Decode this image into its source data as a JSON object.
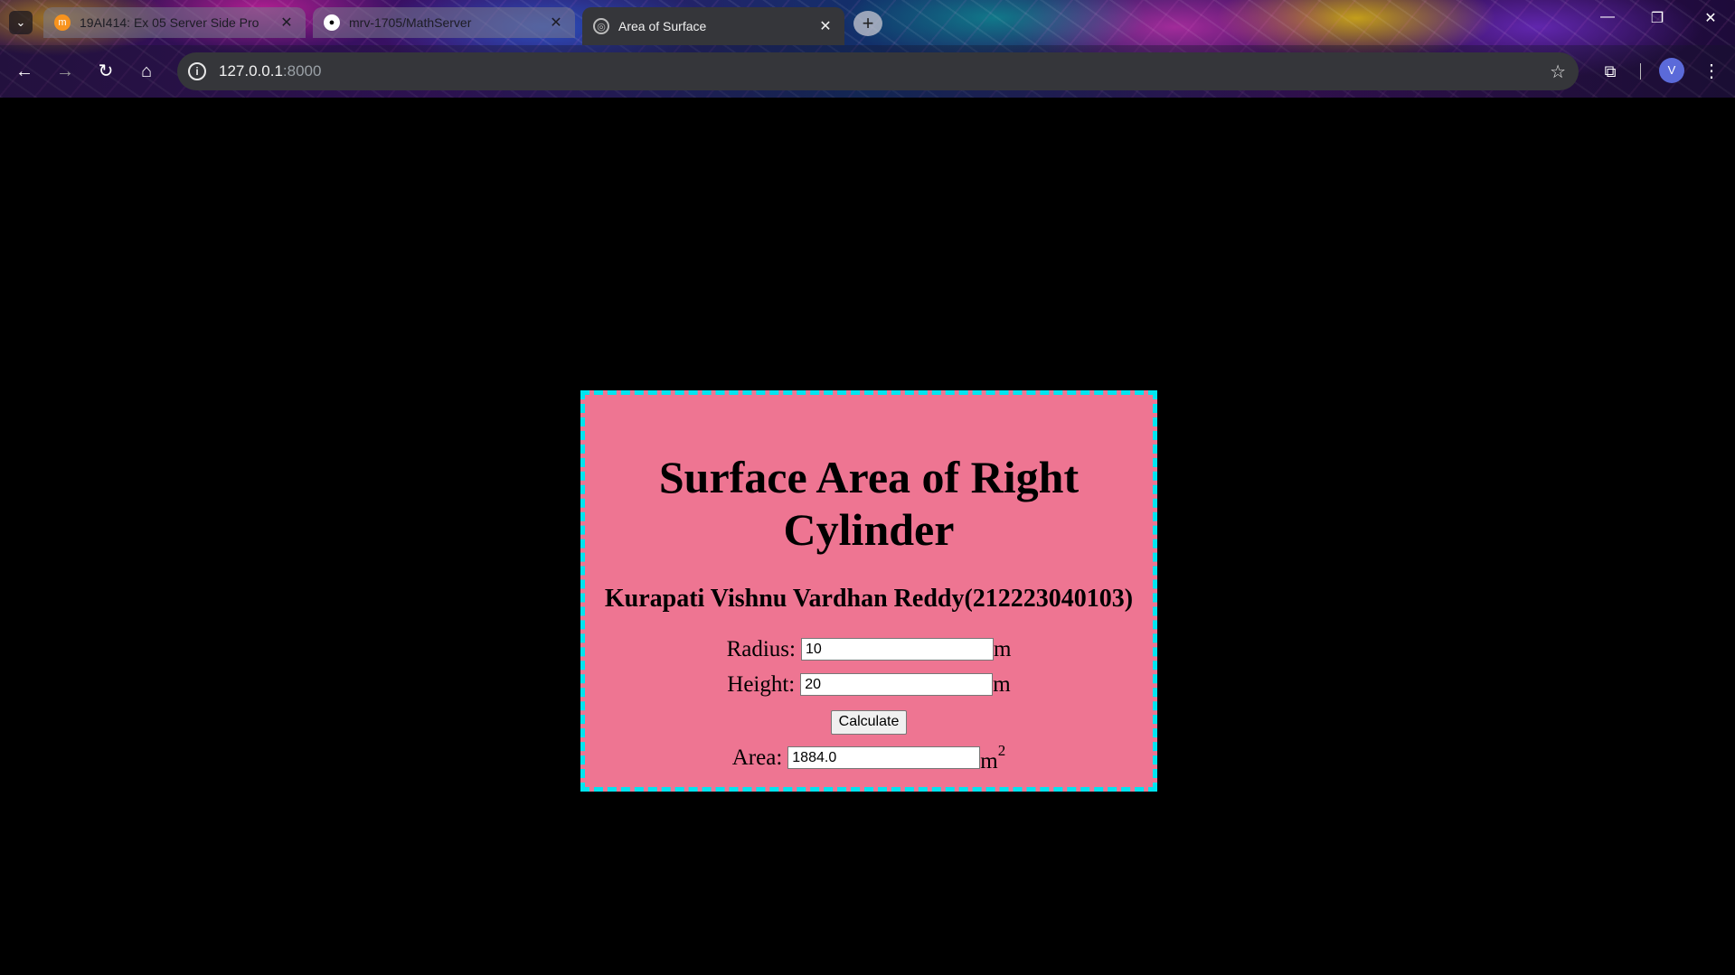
{
  "browser": {
    "tabs": [
      {
        "title": "19AI414: Ex 05 Server Side Pro",
        "favicon": "moodle-icon",
        "active": false
      },
      {
        "title": "mrv-1705/MathServer",
        "favicon": "github-icon",
        "active": false
      },
      {
        "title": "Area of Surface",
        "favicon": "globe-icon",
        "active": true
      }
    ],
    "url_host": "127.0.0.1",
    "url_port": ":8000",
    "profile_initial": "V"
  },
  "page": {
    "title_line1": "Surface Area of Right",
    "title_line2": "Cylinder",
    "author": "Kurapati Vishnu Vardhan Reddy(212223040103)",
    "radius_label": "Radius:",
    "radius_value": "10",
    "radius_unit": "m",
    "height_label": "Height:",
    "height_value": "20",
    "height_unit": "m",
    "calculate_label": "Calculate",
    "area_label": "Area:",
    "area_value": "1884.0",
    "area_unit": "m",
    "area_exponent": "2"
  },
  "colors": {
    "card_background": "#ee7592",
    "card_border": "#00e5f0",
    "page_background": "#000000"
  }
}
